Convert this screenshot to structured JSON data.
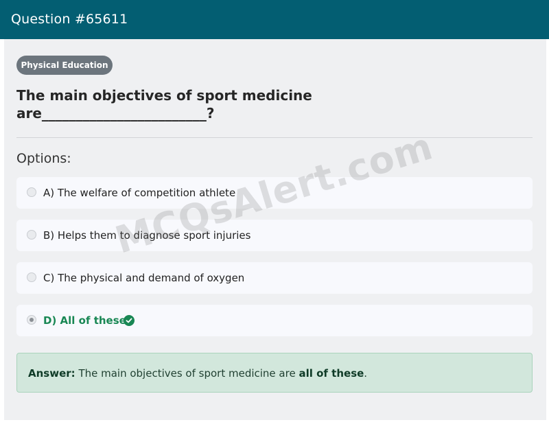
{
  "header": {
    "title": "Question #65611"
  },
  "category_badge": "Physical Education",
  "question": "The main objectives of sport medicine are________________________?",
  "options_label": "Options:",
  "options": [
    {
      "label": "A) The welfare of competition athlete",
      "selected": false,
      "correct": false
    },
    {
      "label": "B) Helps them to diagnose sport injuries",
      "selected": false,
      "correct": false
    },
    {
      "label": "C) The physical and demand of oxygen",
      "selected": false,
      "correct": false
    },
    {
      "label": "D) All of these",
      "selected": true,
      "correct": true,
      "icon": "check-circle-icon"
    }
  ],
  "answer": {
    "label": "Answer:",
    "text_before": "The main objectives of sport medicine are",
    "highlight": "all of these",
    "text_after": "."
  },
  "watermark": "MCQsAlert.com",
  "colors": {
    "header_bg": "#035e72",
    "badge_bg": "#6c757d",
    "correct": "#198754",
    "answer_bg": "#d2e7dc"
  }
}
